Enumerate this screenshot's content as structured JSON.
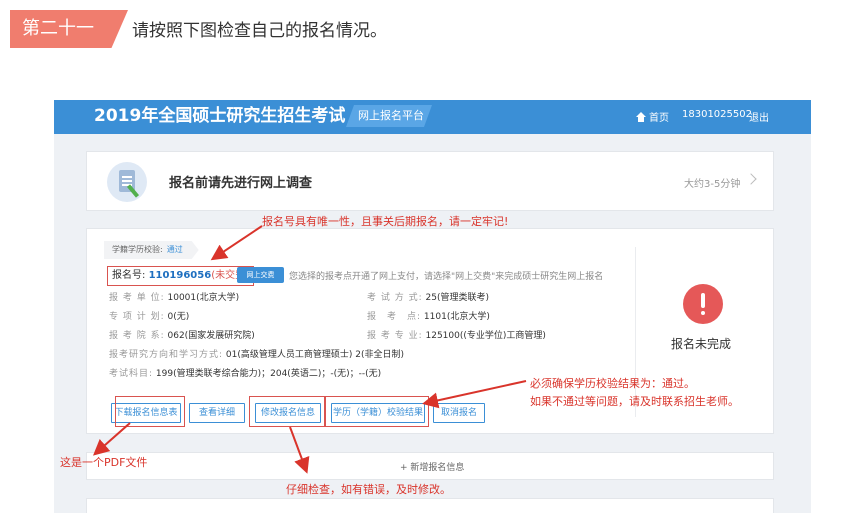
{
  "article": {
    "step_tag": "第二十一",
    "step_text": "请按照下图检查自己的报名情况。"
  },
  "topbar": {
    "site_title": "2019年全国硕士研究生招生考试",
    "platform_tag": "网上报名平台",
    "home_label": "首页",
    "user_phone": "18301025502",
    "logout_label": "退出"
  },
  "survey": {
    "title": "报名前请先进行网上调查",
    "duration": "大约3-5分钟"
  },
  "registration": {
    "verify_label": "学籍学历校验:",
    "verify_status": "通过",
    "reg_no_label": "报名号:",
    "reg_no": "110196056",
    "unpaid": "(未交费)",
    "pay_button": "网上交费",
    "pay_hint": "您选择的报考点开通了网上支付，请选择\"网上交费\"来完成硕士研究生网上报名",
    "fields": {
      "unit_label": "报 考 单 位:",
      "unit_value": "10001(北京大学)",
      "exam_mode_label": "考 试 方 式:",
      "exam_mode_value": "25(管理类联考)",
      "special_label": "专 项 计 划:",
      "special_value": "0(无)",
      "site_label": "报　考　点:",
      "site_value": "1101(北京大学)",
      "dept_label": "报 考 院 系:",
      "dept_value": "062(国家发展研究院)",
      "major_label": "报 考 专 业:",
      "major_value": "125100((专业学位)工商管理)",
      "direction_label": "报考研究方向和学习方式:",
      "direction_value": "01(高级管理人员工商管理硕士) 2(非全日制)",
      "subjects_label": "考试科目:",
      "subjects_value": "199(管理类联考综合能力)；204(英语二)；-(无)；--(无)"
    },
    "buttons": {
      "download": "下载报名信息表",
      "view_detail": "查看详细",
      "modify": "修改报名信息",
      "verify_result": "学历（学籍）校验结果",
      "cancel": "取消报名"
    },
    "status_text": "报名未完成"
  },
  "add_info": "+ 新增报名信息",
  "annotations": {
    "unique_no": "报名号具有唯一性，且事关后期报名，请一定牢记!",
    "must_pass_1": "必须确保学历校验结果为：通过。",
    "must_pass_2": "如果不通过等问题，请及时联系招生老师。",
    "pdf_file": "这是一个PDF文件",
    "check_carefully": "仔细检查，如有错误，及时修改。"
  },
  "colors": {
    "accent": "#3b8fd6",
    "annotation_red": "#d9342b",
    "step_tag": "#f07d6e",
    "alert": "#e55858"
  }
}
